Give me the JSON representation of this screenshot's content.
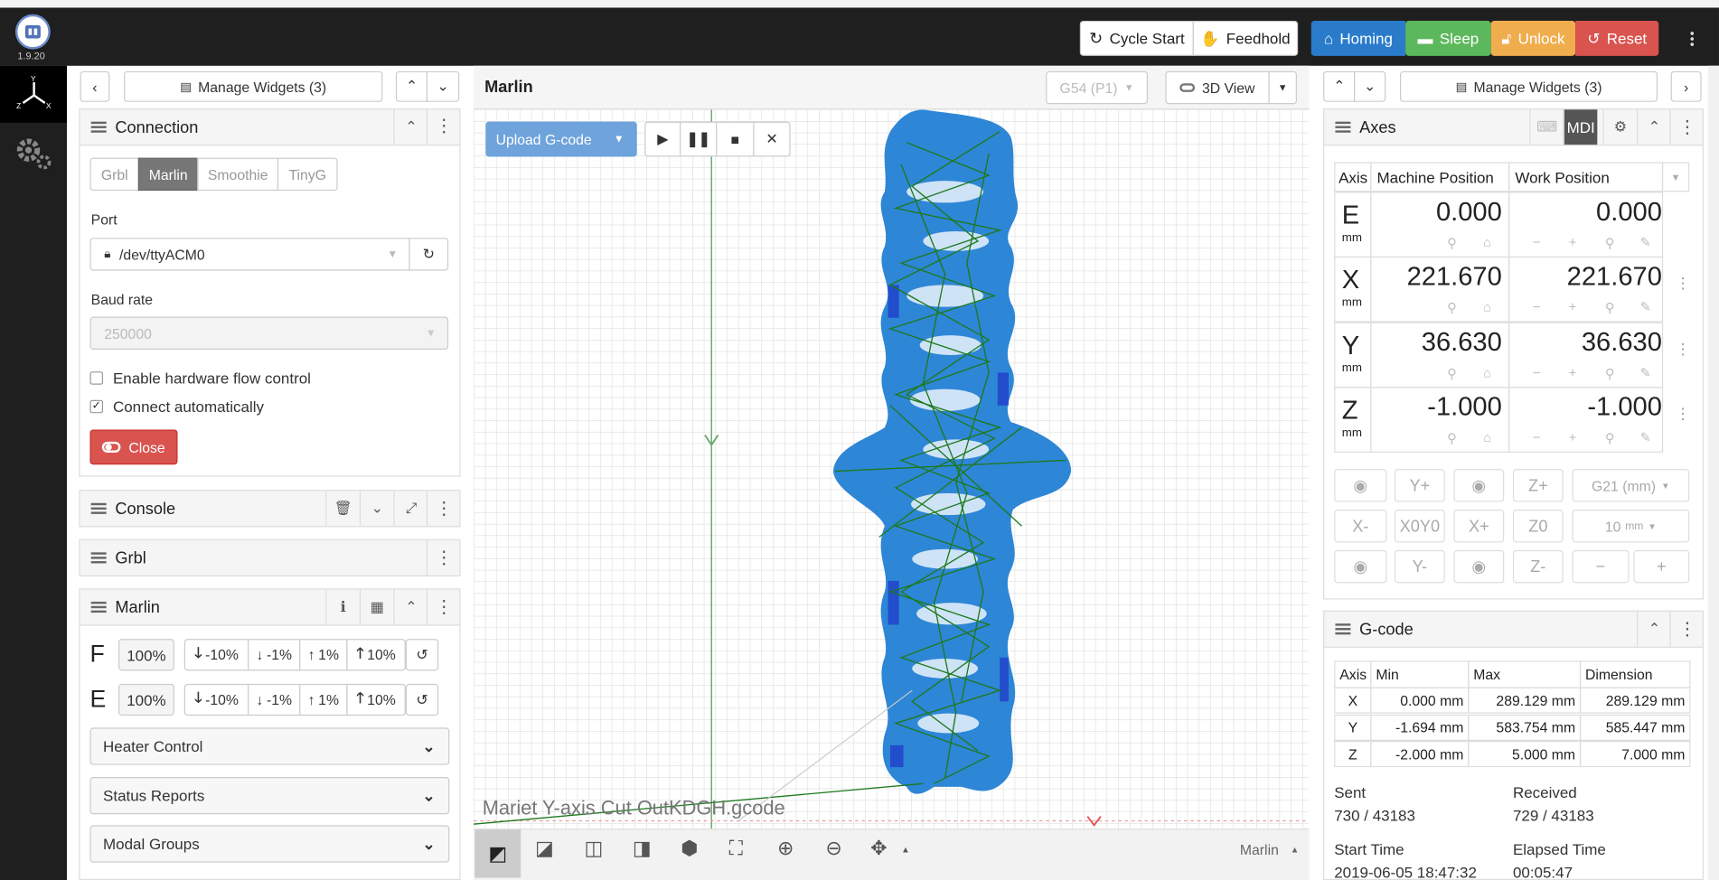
{
  "app": {
    "version": "1.9.20"
  },
  "topbar": {
    "cycle_start": "Cycle Start",
    "feedhold": "Feedhold",
    "homing": "Homing",
    "sleep": "Sleep",
    "unlock": "Unlock",
    "reset": "Reset"
  },
  "colors": {
    "homing": "#2a7ccb",
    "sleep": "#5cb85c",
    "unlock": "#f0ad4e",
    "reset": "#d9534f",
    "topbar": "#1f1f1f",
    "model_blue": "#2e86d6",
    "toolpath_green": "#1c7a1c"
  },
  "left": {
    "manage_widgets": "Manage Widgets (3)",
    "connection": {
      "title": "Connection",
      "tabs": [
        "Grbl",
        "Marlin",
        "Smoothie",
        "TinyG"
      ],
      "active_tab": "Marlin",
      "port_label": "Port",
      "port_value": "/dev/ttyACM0",
      "baud_label": "Baud rate",
      "baud_value": "250000",
      "flow_control": "Enable hardware flow control",
      "flow_checked": false,
      "auto_connect": "Connect automatically",
      "auto_checked": true,
      "close_button": "Close"
    },
    "console": {
      "title": "Console"
    },
    "grbl": {
      "title": "Grbl"
    },
    "marlin": {
      "title": "Marlin",
      "rows": [
        {
          "axis": "F",
          "value": "100%"
        },
        {
          "axis": "E",
          "value": "100%"
        }
      ],
      "steps": [
        "-10%",
        "-1%",
        "1%",
        "10%"
      ],
      "sections": [
        "Heater Control",
        "Status Reports",
        "Modal Groups"
      ]
    }
  },
  "center": {
    "title": "Marlin",
    "wcs": "G54 (P1)",
    "view_toggle": "3D View",
    "upload_button": "Upload G-code",
    "filename": "Mariet Y-axis Cut OutKDGH.gcode",
    "footer_mode": "Marlin"
  },
  "right": {
    "manage_widgets": "Manage Widgets (3)",
    "axes": {
      "title": "Axes",
      "mdi": "MDI",
      "headers": [
        "Axis",
        "Machine Position",
        "Work Position"
      ],
      "rows": [
        {
          "axis": "E",
          "unit": "mm",
          "machine": "0.000",
          "work": "0.000"
        },
        {
          "axis": "X",
          "unit": "mm",
          "machine": "221.670",
          "work": "221.670"
        },
        {
          "axis": "Y",
          "unit": "mm",
          "machine": "36.630",
          "work": "36.630"
        },
        {
          "axis": "Z",
          "unit": "mm",
          "machine": "-1.000",
          "work": "-1.000"
        }
      ],
      "jog": {
        "yplus": "Y+",
        "zplus": "Z+",
        "units": "G21 (mm)",
        "xminus": "X-",
        "xy0": "X0Y0",
        "xplus": "X+",
        "z0": "Z0",
        "step": "10",
        "step_unit": "mm",
        "yminus": "Y-",
        "zminus": "Z-",
        "minus": "−",
        "plus": "+"
      }
    },
    "gcode": {
      "title": "G-code",
      "headers": [
        "Axis",
        "Min",
        "Max",
        "Dimension"
      ],
      "rows": [
        {
          "axis": "X",
          "min": "0.000 mm",
          "max": "289.129 mm",
          "dim": "289.129 mm"
        },
        {
          "axis": "Y",
          "min": "-1.694 mm",
          "max": "583.754 mm",
          "dim": "585.447 mm"
        },
        {
          "axis": "Z",
          "min": "-2.000 mm",
          "max": "5.000 mm",
          "dim": "7.000 mm"
        }
      ],
      "sent_label": "Sent",
      "sent": "730 / 43183",
      "received_label": "Received",
      "received": "729 / 43183",
      "start_label": "Start Time",
      "start": "2019-06-05 18:47:32",
      "elapsed_label": "Elapsed Time",
      "elapsed": "00:05:47"
    }
  }
}
